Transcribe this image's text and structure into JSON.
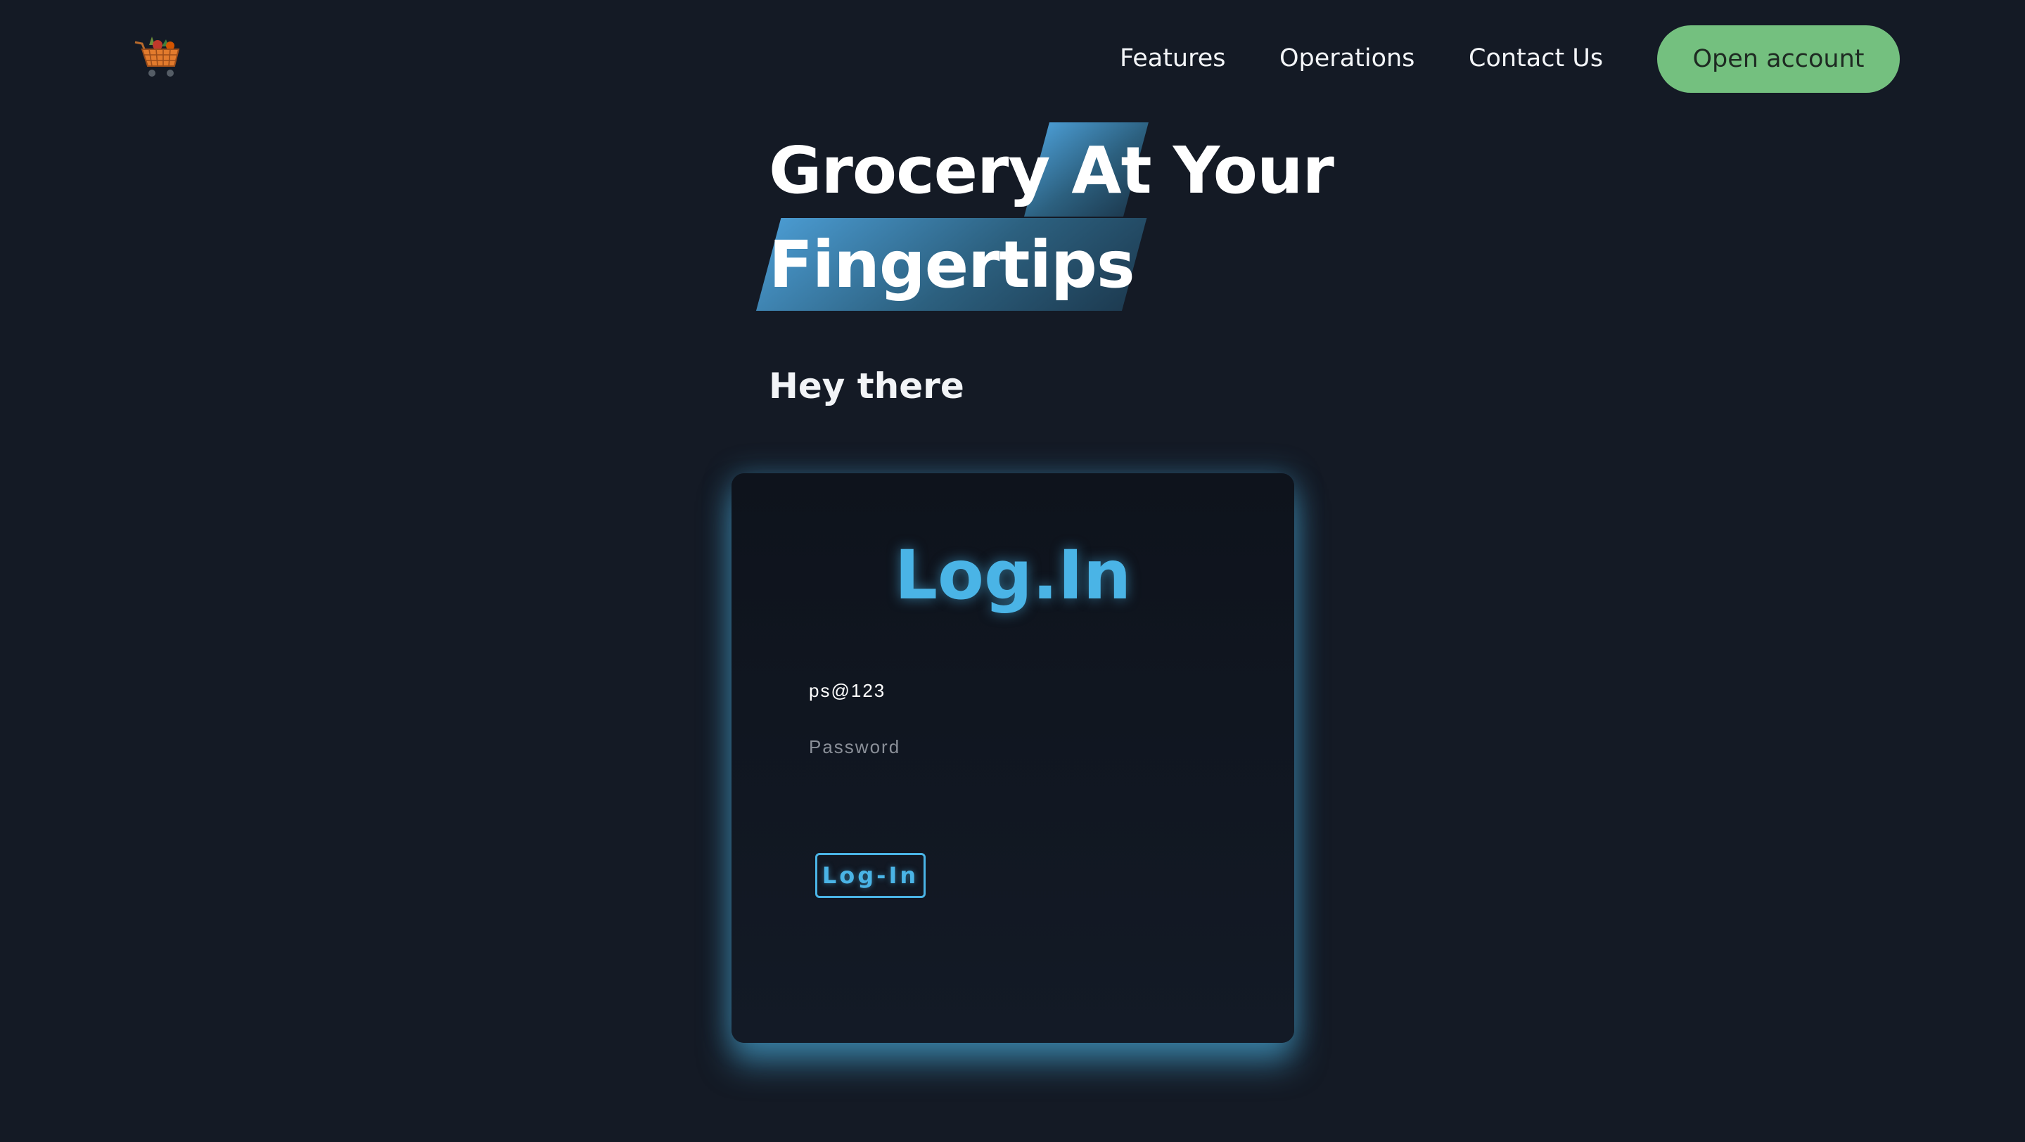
{
  "nav": {
    "logo_icon": "grocery-cart-icon",
    "links": [
      {
        "label": "Features"
      },
      {
        "label": "Operations"
      },
      {
        "label": "Contact Us"
      }
    ],
    "cta_label": "Open account",
    "cta_color": "#74c07f"
  },
  "hero": {
    "line1_start": "Grocery ",
    "line1_highlight": "At",
    "line1_end": " Your",
    "line2": "Fingertips",
    "subtitle": "Hey there",
    "highlight_color": "#3a7ea6"
  },
  "login": {
    "title": "Log.In",
    "username_value": "ps@123",
    "password_placeholder": "Password",
    "button_label": "Log-In",
    "accent_color": "#4ab4e6"
  },
  "colors": {
    "background": "#141a25"
  }
}
